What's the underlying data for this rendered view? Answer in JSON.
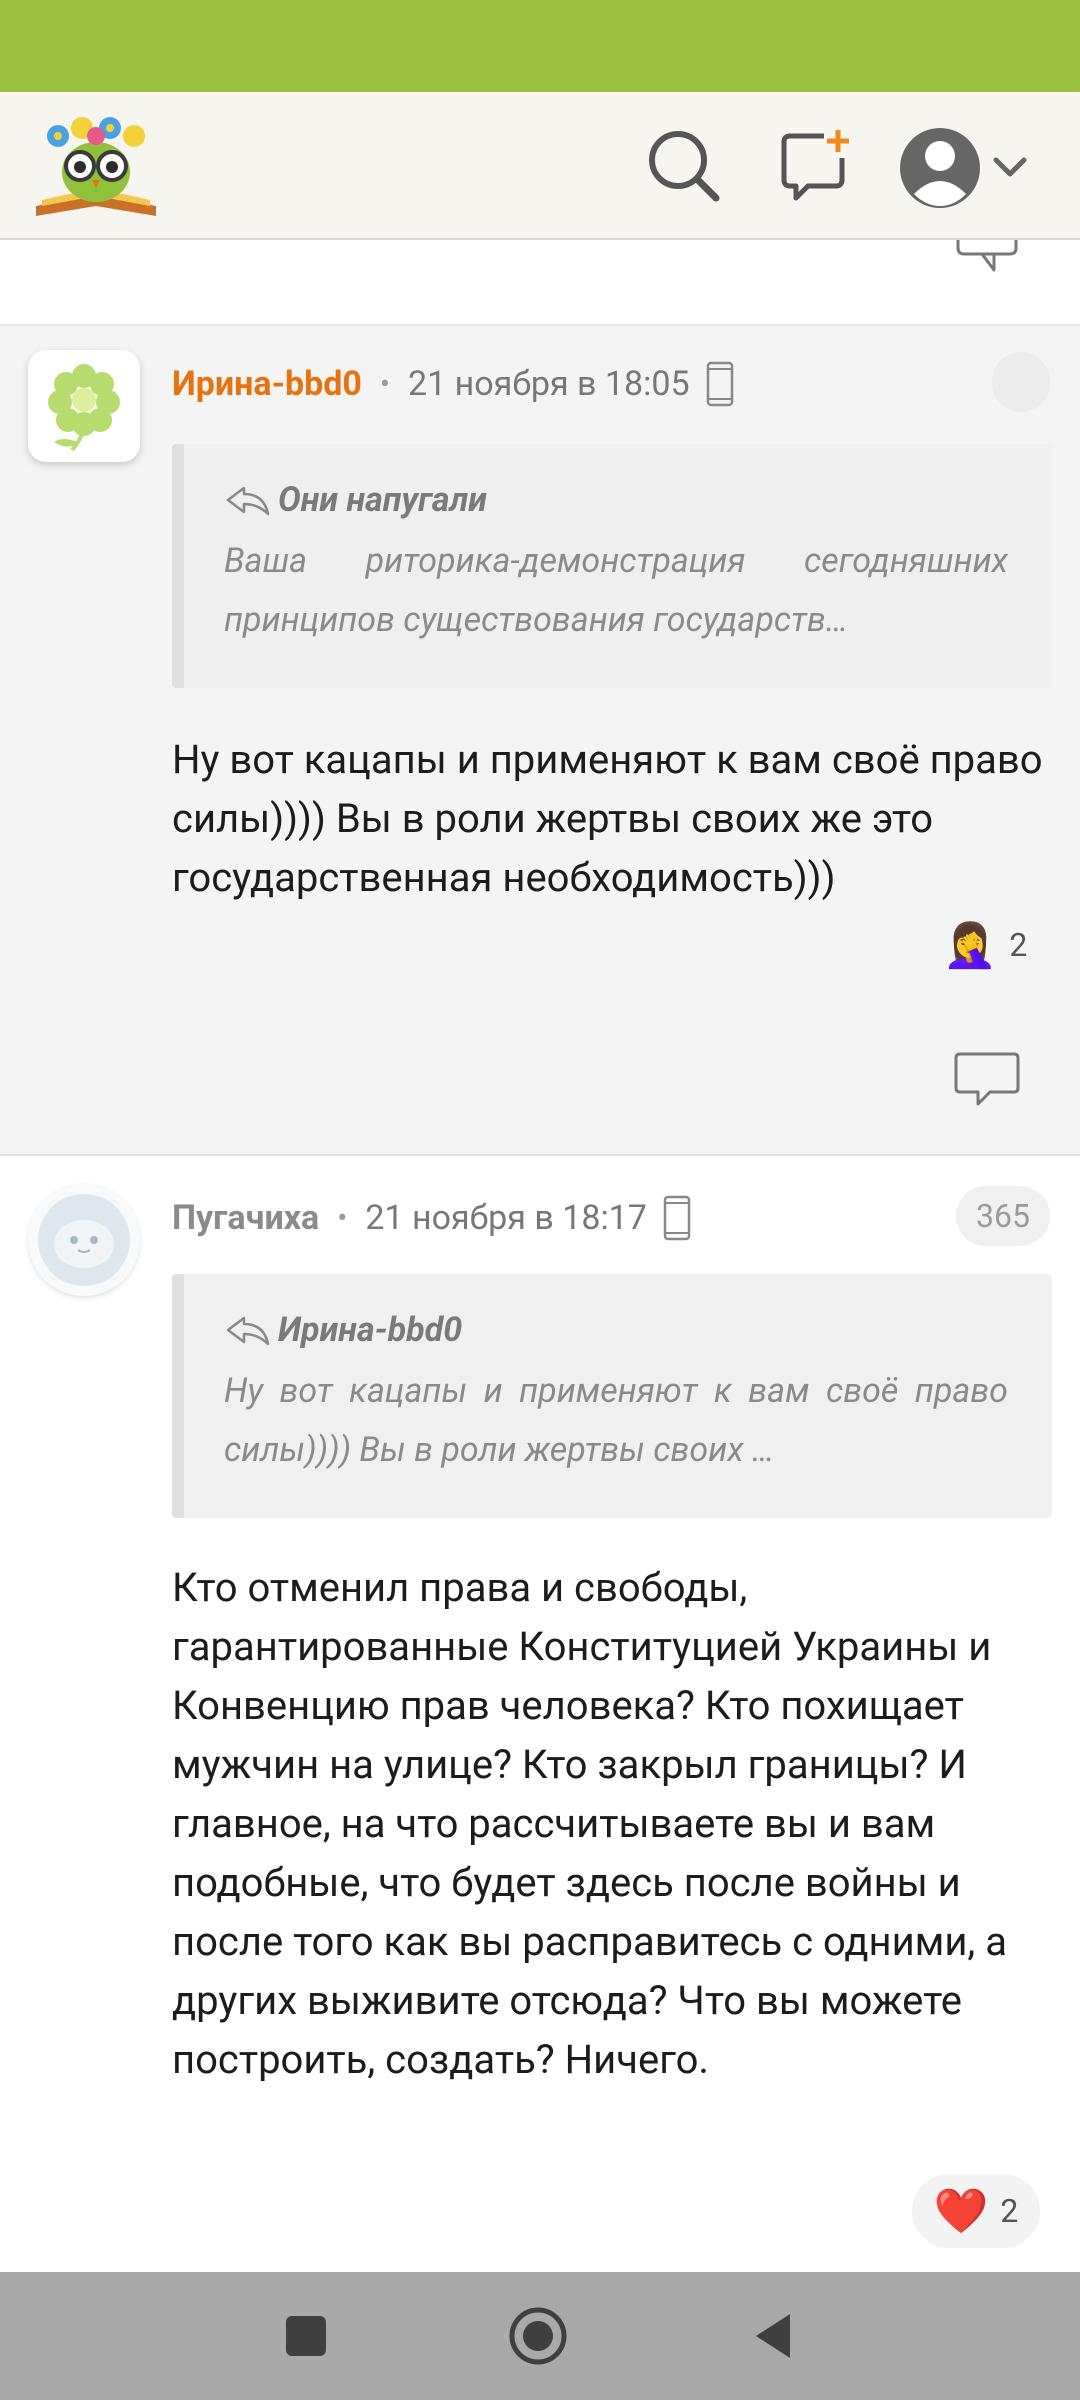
{
  "app": {
    "colors": {
      "statusbar": "#9bbf3f",
      "accent": "#e8720f",
      "navbar": "#a9a9a9"
    }
  },
  "topbar": {
    "logo_icon": "owl-book-logo",
    "search_icon": "search-icon",
    "compose_icon": "new-message-icon",
    "profile_icon": "profile-avatar-icon"
  },
  "comments": [
    {
      "author": "Ирина-bbd0",
      "separator": "•",
      "date": "21 ноября в 18:05",
      "device_icon": "mobile-phone-icon",
      "badge": "",
      "quote": {
        "author": "Они напугали",
        "text": "Ваша риторика-демонстрация сегодняшних принципов существования государств…"
      },
      "text": "Ну вот кацапы и применяют к вам своё право силы)))) Вы в роли жертвы своих же это государственная необходимость)))",
      "reaction": {
        "emoji": "🤦‍♀️",
        "count": "2"
      }
    },
    {
      "author": "Пугачиха",
      "separator": "•",
      "date": "21 ноября в 18:17",
      "device_icon": "mobile-phone-icon",
      "badge": "365",
      "quote": {
        "author": "Ирина-bbd0",
        "text": "Ну вот кацапы и применяют к вам своё право силы)))) Вы в роли жертвы своих …"
      },
      "text": "Кто отменил права и свободы, гарантированные Конституцией Украины и Конвенцию прав человека? Кто похищает мужчин на улице? Кто закрыл границы? И главное, на что рассчитываете вы и вам подобные, что будет здесь после войны и после того как вы расправитесь с одними, а других выживите отсюда? Что вы можете построить, создать? Ничего.",
      "reaction": {
        "emoji": "❤️",
        "count": "2"
      }
    }
  ],
  "navbar": {
    "recents_icon": "recents-square-icon",
    "home_icon": "home-circle-icon",
    "back_icon": "back-triangle-icon"
  }
}
